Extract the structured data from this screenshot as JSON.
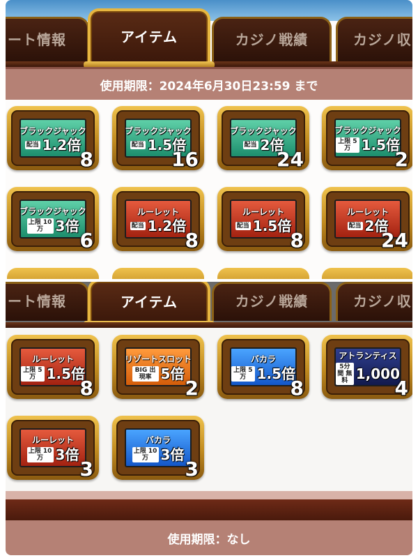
{
  "top_panel": {
    "tabs": [
      {
        "label": "ート情報"
      },
      {
        "label": "アイテム"
      },
      {
        "label": "カジノ戦績"
      },
      {
        "label": "カジノ収"
      }
    ],
    "expiry": "使用期限：2024年6月30日23:59 まで",
    "items": [
      {
        "game": "ブラックジャック",
        "label": "配当",
        "value": "1.2倍",
        "count": "8",
        "color": "#1d8e6d"
      },
      {
        "game": "ブラックジャック",
        "label": "配当",
        "value": "1.5倍",
        "count": "16",
        "color": "#1d8e6d"
      },
      {
        "game": "ブラックジャック",
        "label": "配当",
        "value": "2倍",
        "count": "24",
        "color": "#1d8e6d"
      },
      {
        "game": "ブラックジャック",
        "label": "上限 5万",
        "value": "1.5倍",
        "count": "2",
        "color": "#1d8e6d"
      },
      {
        "game": "ブラックジャック",
        "label": "上限 10万",
        "value": "3倍",
        "count": "6",
        "color": "#1d8e6d"
      },
      {
        "game": "ルーレット",
        "label": "配当",
        "value": "1.2倍",
        "count": "8",
        "color": "#a32211"
      },
      {
        "game": "ルーレット",
        "label": "配当",
        "value": "1.5倍",
        "count": "8",
        "color": "#a32211"
      },
      {
        "game": "ルーレット",
        "label": "配当",
        "value": "2倍",
        "count": "24",
        "color": "#a32211"
      }
    ]
  },
  "bottom_panel": {
    "tabs": [
      {
        "label": "ート情報"
      },
      {
        "label": "アイテム"
      },
      {
        "label": "カジノ戦績"
      },
      {
        "label": "カジノ収"
      }
    ],
    "items": [
      {
        "game": "ルーレット",
        "label": "上限 5万",
        "value": "1.5倍",
        "count": "8",
        "color": "#a32211"
      },
      {
        "game": "リゾートスロット",
        "label": "BIG 出現率",
        "value": "5倍",
        "count": "2",
        "color": "#d45d0a"
      },
      {
        "game": "バカラ",
        "label": "上限 5万",
        "value": "1.5倍",
        "count": "8",
        "color": "#1457c9"
      },
      {
        "game": "アトランティス",
        "label": "5分間 無料",
        "value": "1,000",
        "count": "4",
        "color": "#121a4d"
      },
      {
        "game": "ルーレット",
        "label": "上限 10万",
        "value": "3倍",
        "count": "3",
        "color": "#a32211"
      },
      {
        "game": "バカラ",
        "label": "上限 10万",
        "value": "3倍",
        "count": "3",
        "color": "#1457c9"
      }
    ],
    "expiry": "使用期限：なし"
  }
}
